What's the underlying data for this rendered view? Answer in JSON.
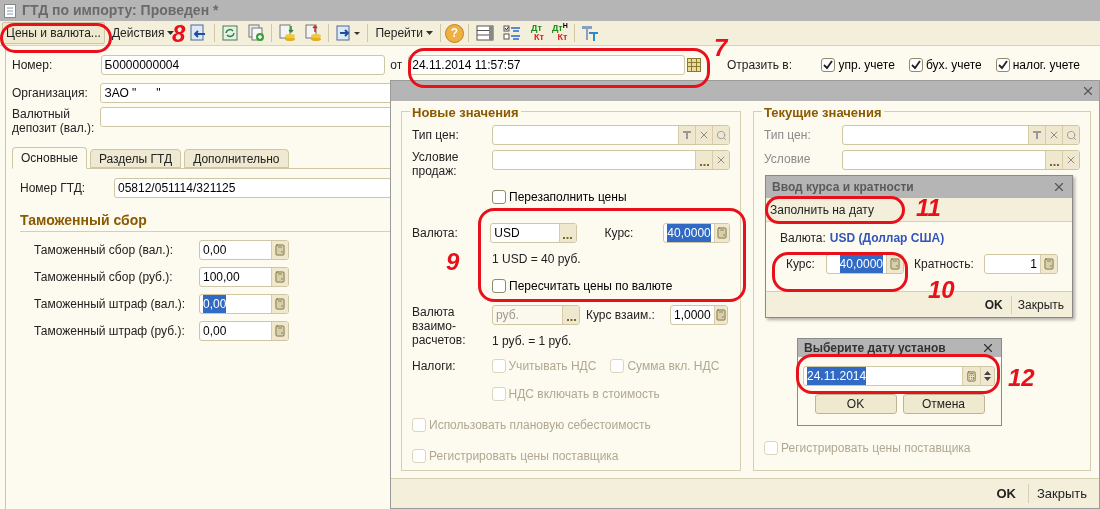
{
  "window": {
    "title": "ГТД по импорту: Проведен *"
  },
  "toolbar": [
    {
      "kind": "button",
      "label": "Цены и валюта..."
    },
    {
      "kind": "menu",
      "label": "Действия"
    },
    {
      "kind": "separator"
    },
    {
      "kind": "icon"
    },
    {
      "kind": "separator"
    },
    {
      "kind": "icon"
    },
    {
      "kind": "icon"
    },
    {
      "kind": "separator"
    },
    {
      "kind": "icon"
    },
    {
      "kind": "icon"
    },
    {
      "kind": "separator"
    },
    {
      "kind": "icon"
    },
    {
      "kind": "separator"
    },
    {
      "kind": "menu",
      "label": "Перейти"
    },
    {
      "kind": "separator"
    },
    {
      "kind": "help",
      "glyph": "?"
    },
    {
      "kind": "separator"
    },
    {
      "kind": "icon"
    },
    {
      "kind": "icon"
    },
    {
      "kind": "dtkt",
      "debit": "Дт",
      "credit": "Кт"
    },
    {
      "kind": "dtkt",
      "debit": "Дт",
      "credit": "Кт",
      "sup": "Н"
    },
    {
      "kind": "separator"
    },
    {
      "kind": "icon"
    }
  ],
  "number": {
    "label": "Номер:",
    "value": "Б0000000004"
  },
  "date": {
    "label": "от",
    "value": "24.11.2014 11:57:57"
  },
  "reflect": {
    "label": "Отразить в:",
    "options": [
      {
        "label": "упр. учете",
        "checked": true
      },
      {
        "label": "бух. учете",
        "checked": true
      },
      {
        "label": "налог. учете",
        "checked": true
      }
    ]
  },
  "organization": {
    "label": "Организация:",
    "value": "ЗАО \"      \""
  },
  "deposit": {
    "label": "Валютный депозит (вал.):"
  },
  "tabs": [
    {
      "label": "Основные",
      "selected": true
    },
    {
      "label": "Разделы ГТД",
      "selected": false
    },
    {
      "label": "Дополнительно",
      "selected": false
    }
  ],
  "gtd_number": {
    "label": "Номер ГТД:",
    "value": "05812/051114/321125"
  },
  "customs": {
    "title": "Таможенный сбор",
    "fields": [
      {
        "label": "Таможенный сбор (вал.):",
        "value": "0,00",
        "selected": false
      },
      {
        "label": "Таможенный сбор (руб.):",
        "value": "100,00",
        "selected": false
      },
      {
        "label": "Таможенный штраф (вал.):",
        "value": "0,00",
        "selected": true
      },
      {
        "label": "Таможенный штраф (руб.):",
        "value": "0,00",
        "selected": false
      }
    ]
  },
  "prices_dialog": {
    "new": {
      "title": "Новые значения",
      "price_type": {
        "label": "Тип цен:"
      },
      "sale_condition": {
        "label": "Условие продаж:"
      },
      "refill": {
        "label": "Перезаполнить цены",
        "checked": false
      },
      "currency": {
        "label": "Валюта:",
        "value": "USD"
      },
      "rate": {
        "label": "Курс:",
        "value": "40,0000",
        "selected": true
      },
      "rate_text": "1 USD = 40 руб.",
      "recalc": {
        "label": "Пересчитать цены по валюте",
        "checked": false
      },
      "settlement_currency": {
        "label": "Валюта взаимо- расчетов:",
        "value": "руб.",
        "disabled": true
      },
      "settlement_rate": {
        "label": "Курс взаим.:",
        "value": "1,0000"
      },
      "settlement_text": "1 руб. = 1 руб.",
      "taxes": {
        "label": "Налоги:",
        "options": [
          {
            "label": "Учитывать НДС",
            "checked": false,
            "disabled": true
          },
          {
            "label": "Сумма вкл. НДС",
            "checked": false,
            "disabled": true
          },
          {
            "label": "НДС включать в стоимость",
            "checked": false,
            "disabled": true
          }
        ]
      },
      "options": [
        {
          "label": "Использовать плановую себестоимость",
          "checked": false,
          "disabled": true
        },
        {
          "label": "Регистрировать цены поставщика",
          "checked": false,
          "disabled": true
        }
      ]
    },
    "current": {
      "title": "Текущие значения",
      "price_type_label": "Тип цен:",
      "sale_condition_label": "Условие",
      "options": [
        {
          "label": "Регистрировать цены поставщика",
          "checked": false,
          "disabled": true
        }
      ]
    },
    "buttons": [
      "OK",
      "Закрыть"
    ]
  },
  "rate_dialog": {
    "title": "Ввод курса и кратности",
    "fill_button": "Заполнить на дату",
    "currency_label": "Валюта:",
    "currency_value": "USD (Доллар США)",
    "rate": {
      "label": "Курс:",
      "value": "40,0000",
      "selected": true
    },
    "multiplicity": {
      "label": "Кратность:",
      "value": "1"
    },
    "buttons": [
      "OK",
      "Закрыть"
    ]
  },
  "date_dialog": {
    "title": "Выберите дату установ",
    "value": "24.11.2014",
    "selected": true,
    "buttons": [
      "OK",
      "Отмена"
    ]
  },
  "annotations": [
    {
      "label": "8"
    },
    {
      "label": "7"
    },
    {
      "label": "9"
    },
    {
      "label": "11"
    },
    {
      "label": "10"
    },
    {
      "label": "12"
    }
  ]
}
